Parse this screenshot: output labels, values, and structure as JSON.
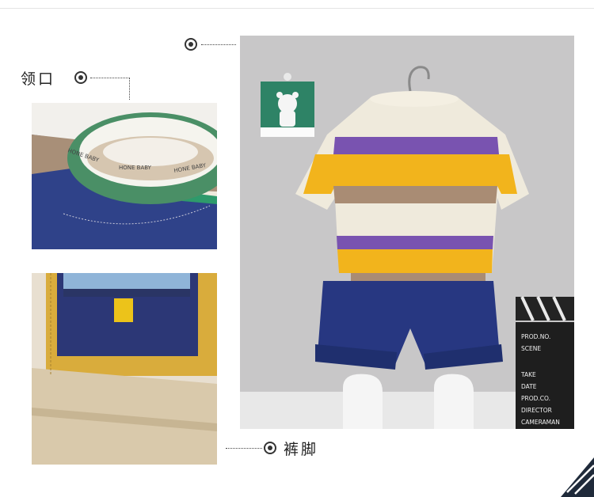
{
  "callouts": {
    "collar_label": "领口",
    "hem_label": "裤脚"
  },
  "collar_tape_text": "HONE BABY",
  "clapperboard": {
    "lines": [
      "PROD.NO.",
      "SCENE",
      "TAKE",
      "DATE",
      "PROD.CO.",
      "DIRECTOR",
      "CAMERAMAN"
    ]
  },
  "colors": {
    "mustard": "#f2b41c",
    "purple": "#7c56b2",
    "tan": "#a98c74",
    "cream": "#f1ecde",
    "navy": "#28387f",
    "green_rib": "#3f8d63",
    "backdrop": "#c9c8c9"
  },
  "icons": [
    "target-icon",
    "hanger-icon",
    "bear-badge-icon",
    "shoe-icon",
    "clapperboard-icon",
    "corner-stripes-icon"
  ]
}
